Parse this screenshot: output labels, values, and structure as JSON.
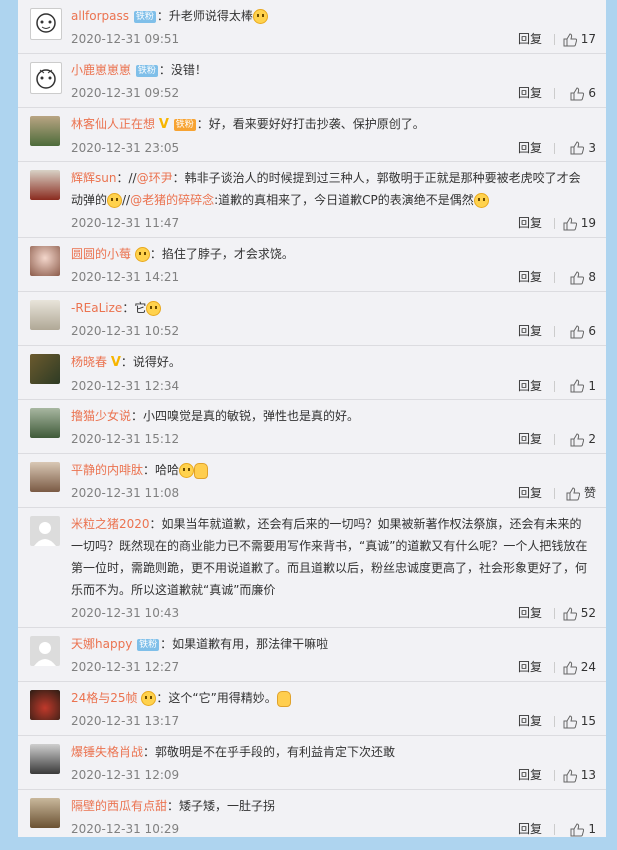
{
  "reply_label": "回复",
  "comments": [
    {
      "user": "allforpass",
      "badge": "铁粉",
      "badge_type": "fan",
      "text": "：升老师说得太棒",
      "emoji_after": true,
      "time": "2020-12-31 09:51",
      "likes": "17",
      "avatar": "cartoon"
    },
    {
      "user": "小鹿崽崽崽",
      "badge": "铁粉",
      "badge_type": "fan",
      "text": "：没错！",
      "time": "2020-12-31 09:52",
      "likes": "6",
      "avatar": "cartoon"
    },
    {
      "user": "林客仙人正在想",
      "vip": "V",
      "badge": "铁粉",
      "badge_type": "gold",
      "text": "：好，看来要好好打击抄袭、保护原创了。",
      "time": "2020-12-31 23:05",
      "likes": "3",
      "avatar": "photo1"
    },
    {
      "user": "辉辉sun",
      "text_parts": [
        "：//",
        "@环尹",
        "：韩非子谈治人的时候提到过三种人，郭敬明于正就是那种要被老虎咬了才会动弹的",
        "//",
        "@老猪的碎碎念",
        ":道歉的真相来了，今日道歉CP的表演绝不是偶然"
      ],
      "time": "2020-12-31 11:47",
      "likes": "19",
      "avatar": "photo2"
    },
    {
      "user": "圆圆的小莓",
      "text": "：掐住了脖子，才会求饶。",
      "time": "2020-12-31 14:21",
      "likes": "8",
      "avatar": "photo3"
    },
    {
      "user": "-REaLize",
      "text": "：它",
      "time": "2020-12-31 10:52",
      "likes": "6",
      "avatar": "photo4"
    },
    {
      "user": "杨晓春",
      "vip": "V",
      "text": "：说得好。",
      "time": "2020-12-31 12:34",
      "likes": "1",
      "avatar": "photo5"
    },
    {
      "user": "撸猫少女说",
      "text": "：小四嗅觉是真的敏锐，弹性也是真的好。",
      "time": "2020-12-31 15:12",
      "likes": "2",
      "avatar": "photo6"
    },
    {
      "user": "平静的内啡肽",
      "text": "：哈哈",
      "time": "2020-12-31 11:08",
      "likes": "赞",
      "avatar": "photo7"
    },
    {
      "user": "米粒之猪2020",
      "text": "：如果当年就道歉，还会有后来的一切吗？如果被新著作权法祭旗，还会有未来的一切吗？既然现在的商业能力已不需要用写作来背书，“真诚”的道歉又有什么呢？一个人把钱放在第一位时，需跪则跪，更不用说道歉了。而且道歉以后，粉丝忠诚度更高了，社会形象更好了，何乐而不为。所以这道歉就“真诚”而廉价",
      "time": "2020-12-31 10:43",
      "likes": "52",
      "avatar": "default"
    },
    {
      "user": "天娜happy",
      "badge": "铁粉",
      "badge_type": "fan",
      "text": "：如果道歉有用，那法律干嘛啦",
      "time": "2020-12-31 12:27",
      "likes": "24",
      "avatar": "default"
    },
    {
      "user": "24格与25帧",
      "text": "：这个“它”用得精妙。",
      "time": "2020-12-31 13:17",
      "likes": "15",
      "avatar": "photo8"
    },
    {
      "user": "爆锤失格肖战",
      "text": "：郭敬明是不在乎手段的，有利益肯定下次还敢",
      "time": "2020-12-31 12:09",
      "likes": "13",
      "avatar": "photo9"
    },
    {
      "user": "隔壁的西瓜有点甜",
      "text": "：矮子矮，一肚子拐",
      "time": "2020-12-31 10:29",
      "likes": "1",
      "avatar": "photo10"
    }
  ]
}
